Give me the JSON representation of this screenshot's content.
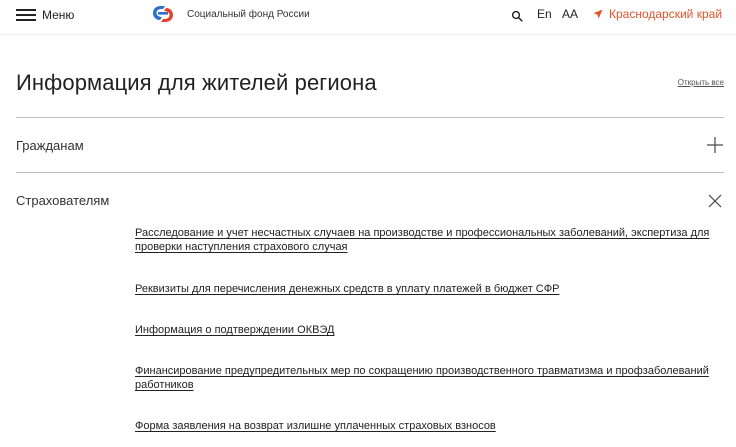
{
  "header": {
    "menu_label": "Меню",
    "logo_text": "Социальный фонд России",
    "lang_label": "En",
    "font_size_label": "АА",
    "region_label": "Краснодарский край"
  },
  "main": {
    "title": "Информация для жителей региона",
    "open_all_label": "Открыть все",
    "sections": [
      {
        "label": "Гражданам",
        "state": "collapsed"
      },
      {
        "label": "Страхователям",
        "state": "expanded"
      }
    ],
    "links": [
      "Расследование и учет несчастных случаев на производстве и профессиональных заболеваний, экспертиза для проверки наступления страхового случая",
      "Реквизиты для перечисления денежных средств в уплату платежей в бюджет СФР",
      "Информация о подтверждении ОКВЭД",
      "Финансирование предупредительных мер по сокращению производственного травматизма и профзаболеваний работников",
      "Форма заявления на возврат излишне уплаченных страховых взносов"
    ]
  },
  "colors": {
    "accent": "#e0552b",
    "logo_blue": "#2d6fc6",
    "logo_red": "#e3412b"
  },
  "icons": {
    "menu": "burger-menu-icon",
    "logo": "sfr-logo-icon",
    "search": "search-icon",
    "region": "location-arrow-icon",
    "expand": "plus-icon",
    "collapse": "close-icon"
  }
}
